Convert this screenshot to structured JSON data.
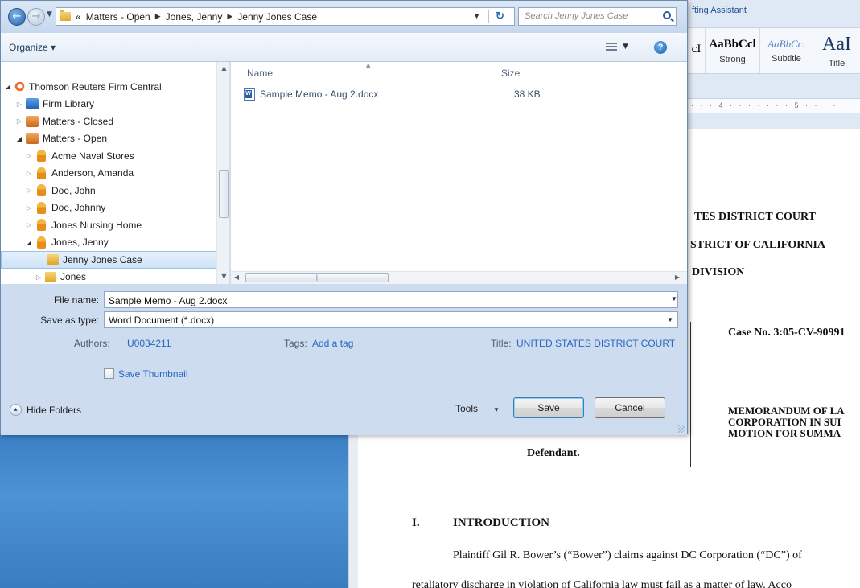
{
  "word": {
    "ribbon_title": "fting Assistant",
    "styles": [
      {
        "sample": "cI",
        "name": ""
      },
      {
        "sample": "AaBbCcl",
        "name": "Strong"
      },
      {
        "sample": "AaBbCc.",
        "name": "Subtitle"
      },
      {
        "sample": "AaI",
        "name": "Title"
      }
    ],
    "ruler": "· · · 4 · · · · · · · 5 · · · ·",
    "court_line1": "TES DISTRICT COURT",
    "court_line2": "STRICT OF CALIFORNIA",
    "court_line3": "DIVISION",
    "case_no": "Case No.  3:05-CV-90991",
    "memo_line1": "MEMORANDUM OF LA",
    "memo_line2": "CORPORATION IN SUI",
    "memo_line3": "MOTION FOR SUMMA",
    "defendant": "Defendant.",
    "section_num": "I.",
    "section_title": "INTRODUCTION",
    "para1": "Plaintiff Gil R. Bower’s (“Bower”) claims against DC Corporation (“DC”) of",
    "para2": "retaliatory discharge in violation of California law must fail as a matter of law.  Acco"
  },
  "dialog": {
    "breadcrumb": [
      "«",
      "Matters - Open",
      "Jones, Jenny",
      "Jenny Jones Case"
    ],
    "search_placeholder": "Search Jenny Jones Case",
    "organize_label": "Organize ▾",
    "nav_tree": [
      {
        "label": "Thomson Reuters Firm Central",
        "indent": 0,
        "icon": "thomson-reuters-icon",
        "expanded": true,
        "selected": false
      },
      {
        "label": "Firm Library",
        "indent": 1,
        "icon": "library-icon",
        "expanded": false,
        "selected": false
      },
      {
        "label": "Matters - Closed",
        "indent": 1,
        "icon": "cabinet-icon",
        "expanded": false,
        "selected": false
      },
      {
        "label": "Matters - Open",
        "indent": 1,
        "icon": "cabinet-icon",
        "expanded": true,
        "selected": false
      },
      {
        "label": "Acme Naval Stores",
        "indent": 2,
        "icon": "client-icon",
        "expanded": false,
        "selected": false
      },
      {
        "label": "Anderson, Amanda",
        "indent": 2,
        "icon": "client-icon",
        "expanded": false,
        "selected": false
      },
      {
        "label": "Doe, John",
        "indent": 2,
        "icon": "client-icon",
        "expanded": false,
        "selected": false
      },
      {
        "label": "Doe, Johnny",
        "indent": 2,
        "icon": "client-icon",
        "expanded": false,
        "selected": false
      },
      {
        "label": "Jones Nursing Home",
        "indent": 2,
        "icon": "client-icon",
        "expanded": false,
        "selected": false
      },
      {
        "label": "Jones, Jenny",
        "indent": 2,
        "icon": "client-icon",
        "expanded": true,
        "selected": false
      },
      {
        "label": "Jenny Jones Case",
        "indent": 3,
        "icon": "folder-icon",
        "expanded": null,
        "selected": true
      },
      {
        "label": "Jones",
        "indent": 3,
        "icon": "folder-icon",
        "expanded": false,
        "selected": false
      }
    ],
    "columns": {
      "name": "Name",
      "size": "Size"
    },
    "files": [
      {
        "name": "Sample Memo - Aug 2.docx",
        "size": "38 KB",
        "icon": "word-doc-icon"
      }
    ],
    "file_name_label": "File name:",
    "file_name_value": "Sample Memo - Aug 2.docx",
    "save_type_label": "Save as type:",
    "save_type_value": "Word Document (*.docx)",
    "authors_label": "Authors:",
    "authors_value": "U0034211",
    "tags_label": "Tags:",
    "tags_value": "Add a tag",
    "title_label": "Title:",
    "title_value": "UNITED STATES DISTRICT COURT",
    "save_thumbnail_label": "Save Thumbnail",
    "hide_folders_label": "Hide Folders",
    "tools_label": "Tools",
    "save_label": "Save",
    "cancel_label": "Cancel"
  }
}
